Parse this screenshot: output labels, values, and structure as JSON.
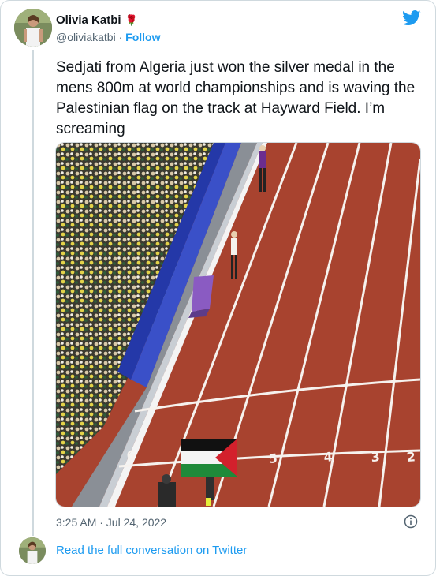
{
  "author": {
    "name": "Olivia Katbi",
    "emoji": "🌹",
    "handle": "@oliviakatbi",
    "separator": "·",
    "follow_label": "Follow"
  },
  "tweet": {
    "text": "Sedjati from Algeria just won the silver medal in the mens 800m at world championships and is waving the Palestinian flag on the track at Hayward Field. I’m screaming",
    "timestamp": "3:25 AM · Jul 24, 2022"
  },
  "footer": {
    "read_full": "Read the full conversation on Twitter"
  },
  "colors": {
    "accent": "#1d9bf0",
    "track": "#a8432f",
    "muted": "#536471"
  },
  "icons": {
    "logo": "twitter-bird-icon",
    "info": "info-icon",
    "emoji": "rose-emoji"
  }
}
